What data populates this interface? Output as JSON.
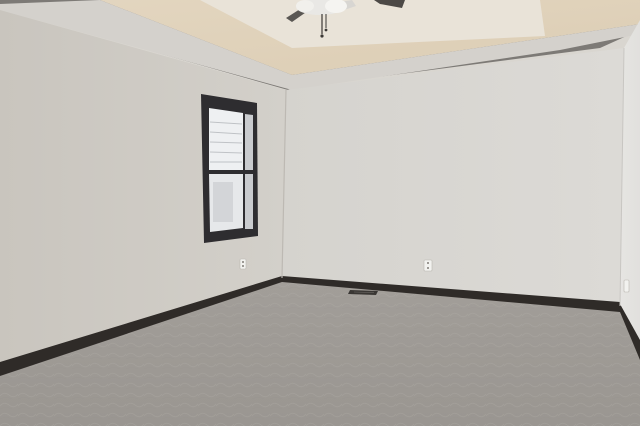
{
  "scene": {
    "subject": "empty-room",
    "colors": {
      "left_wall": "#cfcbc4",
      "back_wall": "#dad8d3",
      "right_wall": "#e4e3e0",
      "ceiling": "#e6e0d4",
      "tray_ceiling": "#e0d3bd",
      "carpet": "#9f9b97",
      "baseboard": "#2f2b28",
      "window_frame": "#2e2d30",
      "outlet": "#f2f2ef"
    },
    "icons": {
      "ceiling_fan": "ceiling-fan-icon",
      "outlet": "outlet-icon",
      "floor_vent": "floor-vent-icon"
    }
  }
}
